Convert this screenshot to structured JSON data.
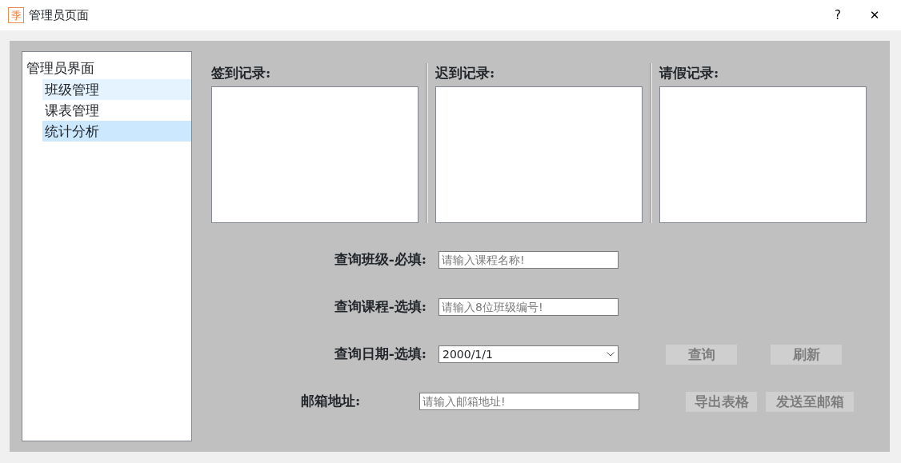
{
  "window": {
    "title": "管理员页面",
    "icon_text": "季",
    "help": "?",
    "close": "✕"
  },
  "tree": {
    "label": "管理员界面",
    "children": [
      {
        "label": "班级管理",
        "selected": false,
        "hovered": true
      },
      {
        "label": "课表管理",
        "selected": false,
        "hovered": false
      },
      {
        "label": "统计分析",
        "selected": true,
        "hovered": false
      }
    ]
  },
  "records": [
    {
      "label": "签到记录:"
    },
    {
      "label": "迟到记录:"
    },
    {
      "label": "请假记录:"
    }
  ],
  "form": [
    {
      "kind": "text",
      "label": "查询班级-必填:",
      "placeholder": "请输入课程名称!"
    },
    {
      "kind": "text",
      "label": "查询课程-选填:",
      "placeholder": "请输入8位班级编号!"
    },
    {
      "kind": "date",
      "label": "查询日期-选填:",
      "value": "2000/1/1",
      "buttons": [
        {
          "label": "查询",
          "disabled": true
        },
        {
          "label": "刷新",
          "disabled": true
        }
      ]
    },
    {
      "kind": "email",
      "label": "邮箱地址:",
      "placeholder": "请输入邮箱地址!",
      "buttons": [
        {
          "label": "导出表格",
          "disabled": true
        },
        {
          "label": "发送至邮箱",
          "disabled": true
        }
      ]
    }
  ]
}
